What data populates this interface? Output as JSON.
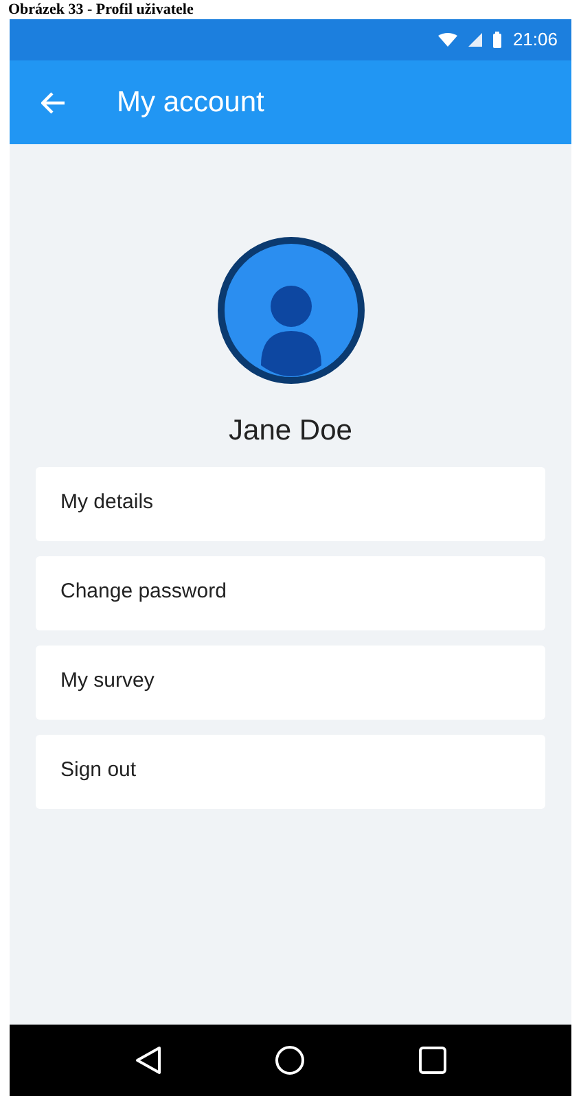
{
  "caption": "Obrázek 33 - Profil uživatele",
  "status_bar": {
    "time": "21:06"
  },
  "app_bar": {
    "title": "My account"
  },
  "profile": {
    "name": "Jane Doe"
  },
  "menu_items": [
    {
      "label": "My details"
    },
    {
      "label": "Change password"
    },
    {
      "label": "My survey"
    },
    {
      "label": "Sign out"
    }
  ]
}
